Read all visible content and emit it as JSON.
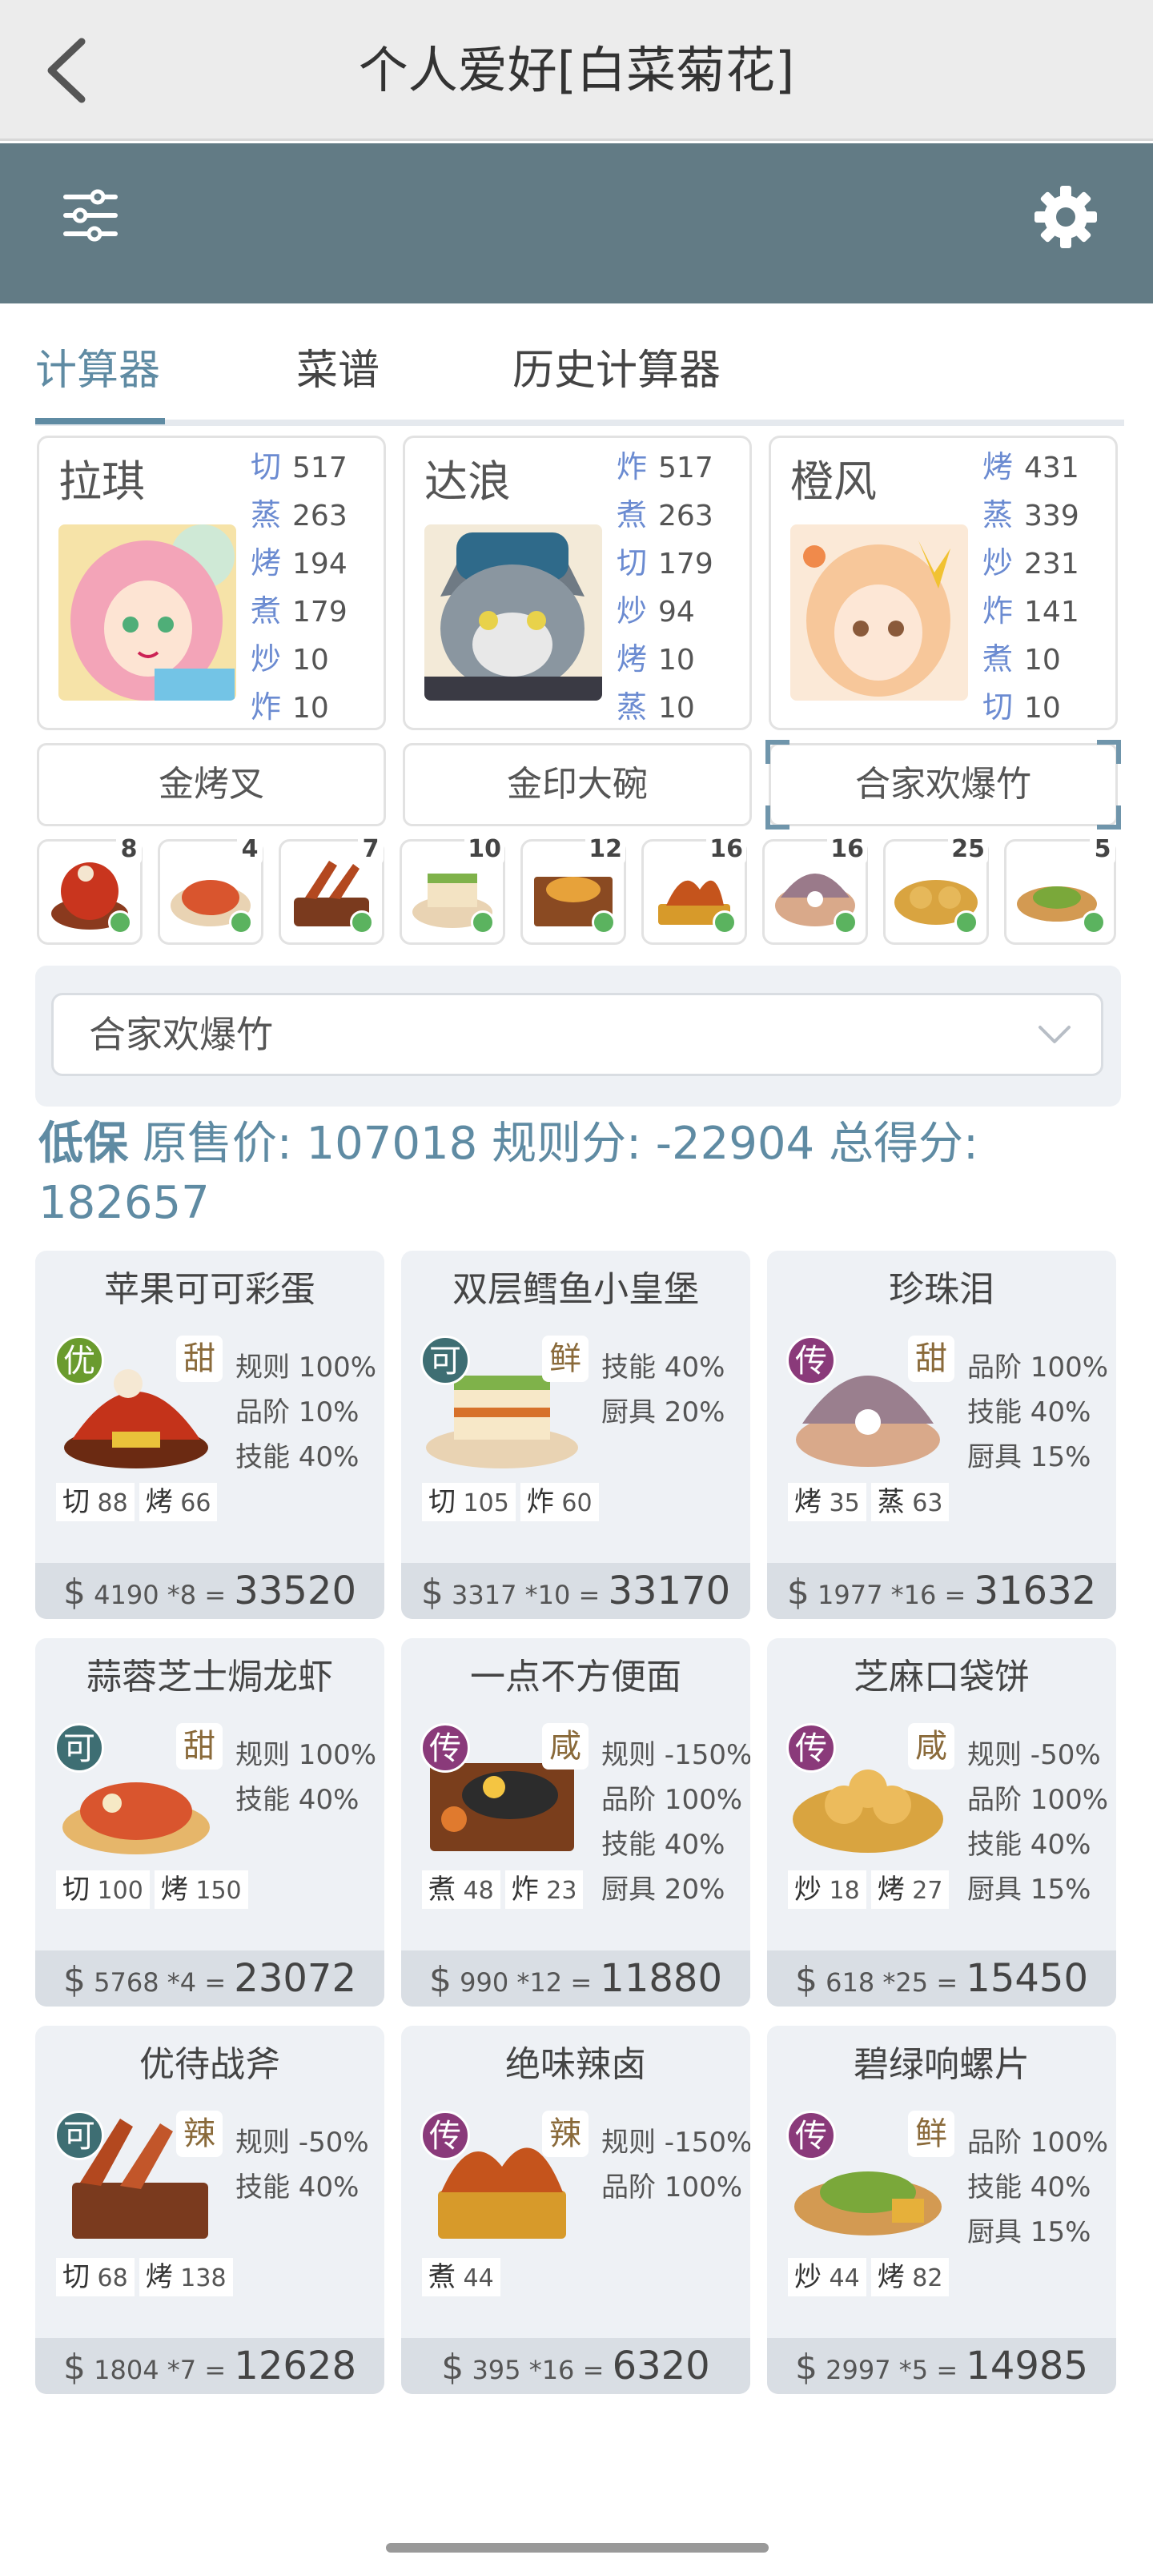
{
  "header": {
    "title": "个人爱好[白菜菊花]",
    "back_icon": "chevron-left-icon"
  },
  "toolbar": {
    "filter_icon": "sliders-icon",
    "settings_icon": "gear-icon"
  },
  "tabs": [
    {
      "label": "计算器",
      "active": true
    },
    {
      "label": "菜谱"
    },
    {
      "label": "历史计算器"
    }
  ],
  "chefs": [
    {
      "name": "拉琪",
      "stats": [
        {
          "k": "切",
          "v": "517"
        },
        {
          "k": "蒸",
          "v": "263"
        },
        {
          "k": "烤",
          "v": "194"
        },
        {
          "k": "煮",
          "v": "179"
        },
        {
          "k": "炒",
          "v": "10"
        },
        {
          "k": "炸",
          "v": "10"
        }
      ],
      "equip": "金烤叉"
    },
    {
      "name": "达浪",
      "stats": [
        {
          "k": "炸",
          "v": "517"
        },
        {
          "k": "煮",
          "v": "263"
        },
        {
          "k": "切",
          "v": "179"
        },
        {
          "k": "炒",
          "v": "94"
        },
        {
          "k": "烤",
          "v": "10"
        },
        {
          "k": "蒸",
          "v": "10"
        }
      ],
      "equip": "金印大碗"
    },
    {
      "name": "橙风",
      "stats": [
        {
          "k": "烤",
          "v": "431"
        },
        {
          "k": "蒸",
          "v": "339"
        },
        {
          "k": "炒",
          "v": "231"
        },
        {
          "k": "炸",
          "v": "141"
        },
        {
          "k": "煮",
          "v": "10"
        },
        {
          "k": "切",
          "v": "10"
        }
      ],
      "equip": "合家欢爆竹"
    }
  ],
  "mini_counts": [
    "8",
    "4",
    "7",
    "10",
    "12",
    "16",
    "16",
    "25",
    "5"
  ],
  "select": {
    "value": "合家欢爆竹"
  },
  "summary": {
    "label1": "低保",
    "label2": "原售价:",
    "price": "107018",
    "label3": "规则分:",
    "rule": "-22904",
    "label4": "总得分:",
    "total": "182657"
  },
  "dishes": [
    {
      "name": "苹果可可彩蛋",
      "rarity": "优",
      "rarity_color": "#6a9b2e",
      "flavor": "甜",
      "tags": [
        "规则 100%",
        "品阶 10%",
        "技能 40%"
      ],
      "skills": [
        {
          "k": "切",
          "v": "88"
        },
        {
          "k": "烤",
          "v": "66"
        }
      ],
      "price": "4190",
      "qty": "*8",
      "total": "33520"
    },
    {
      "name": "双层鳕鱼小皇堡",
      "rarity": "可",
      "rarity_color": "#3e6e73",
      "flavor": "鲜",
      "tags": [
        "技能 40%",
        "厨具 20%"
      ],
      "skills": [
        {
          "k": "切",
          "v": "105"
        },
        {
          "k": "炸",
          "v": "60"
        }
      ],
      "price": "3317",
      "qty": "*10",
      "total": "33170"
    },
    {
      "name": "珍珠泪",
      "rarity": "传",
      "rarity_color": "#8a3a7a",
      "flavor": "甜",
      "tags": [
        "品阶 100%",
        "技能 40%",
        "厨具 15%"
      ],
      "skills": [
        {
          "k": "烤",
          "v": "35"
        },
        {
          "k": "蒸",
          "v": "63"
        }
      ],
      "price": "1977",
      "qty": "*16",
      "total": "31632"
    },
    {
      "name": "蒜蓉芝士焗龙虾",
      "rarity": "可",
      "rarity_color": "#3e6e73",
      "flavor": "甜",
      "tags": [
        "规则 100%",
        "技能 40%"
      ],
      "skills": [
        {
          "k": "切",
          "v": "100"
        },
        {
          "k": "烤",
          "v": "150"
        }
      ],
      "price": "5768",
      "qty": "*4",
      "total": "23072"
    },
    {
      "name": "一点不方便面",
      "rarity": "传",
      "rarity_color": "#8a3a7a",
      "flavor": "咸",
      "tags": [
        "规则 -150%",
        "品阶 100%",
        "技能 40%",
        "厨具 20%"
      ],
      "skills": [
        {
          "k": "煮",
          "v": "48"
        },
        {
          "k": "炸",
          "v": "23"
        }
      ],
      "price": "990",
      "qty": "*12",
      "total": "11880"
    },
    {
      "name": "芝麻口袋饼",
      "rarity": "传",
      "rarity_color": "#8a3a7a",
      "flavor": "咸",
      "tags": [
        "规则 -50%",
        "品阶 100%",
        "技能 40%",
        "厨具 15%"
      ],
      "skills": [
        {
          "k": "炒",
          "v": "18"
        },
        {
          "k": "烤",
          "v": "27"
        }
      ],
      "price": "618",
      "qty": "*25",
      "total": "15450"
    },
    {
      "name": "优待战斧",
      "rarity": "可",
      "rarity_color": "#3e6e73",
      "flavor": "辣",
      "tags": [
        "规则 -50%",
        "技能 40%"
      ],
      "skills": [
        {
          "k": "切",
          "v": "68"
        },
        {
          "k": "烤",
          "v": "138"
        }
      ],
      "price": "1804",
      "qty": "*7",
      "total": "12628"
    },
    {
      "name": "绝味辣卤",
      "rarity": "传",
      "rarity_color": "#8a3a7a",
      "flavor": "辣",
      "tags": [
        "规则 -150%",
        "品阶 100%"
      ],
      "skills": [
        {
          "k": "煮",
          "v": "44"
        }
      ],
      "price": "395",
      "qty": "*16",
      "total": "6320"
    },
    {
      "name": "碧绿响螺片",
      "rarity": "传",
      "rarity_color": "#8a3a7a",
      "flavor": "鲜",
      "tags": [
        "品阶 100%",
        "技能 40%",
        "厨具 15%"
      ],
      "skills": [
        {
          "k": "炒",
          "v": "44"
        },
        {
          "k": "烤",
          "v": "82"
        }
      ],
      "price": "2997",
      "qty": "*5",
      "total": "14985"
    }
  ],
  "colors": {
    "toolbar": "#627b85",
    "accent": "#5f8ba3",
    "card": "#eef1f5"
  }
}
